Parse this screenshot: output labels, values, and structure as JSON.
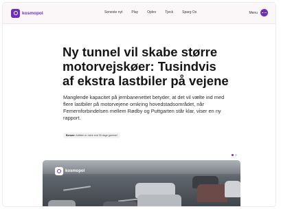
{
  "brand": {
    "name": "kosmopol",
    "logo_icon": "kosmopol-logo-icon",
    "accent_color": "#6f2dbd"
  },
  "nav": {
    "items": [
      {
        "label": "Seneste nyt"
      },
      {
        "label": "Play"
      },
      {
        "label": "Oplev"
      },
      {
        "label": "Tjeck"
      },
      {
        "label": "Sparg Os"
      }
    ],
    "menu_label": "Menu",
    "menu_icon": "more-dots-icon"
  },
  "article": {
    "headline": "Ny tunnel vil skabe større motorvejskøer: Tusindvis af ekstra lastbiler på vejene",
    "lead": "Manglende kapacitet på jernbanenettet betyder, at det vil vælte ind med flere lastbiler på motorvejene omkring hovedstadsområdet, når Femernforbindelsen mellem Rødby og Puttgarten står klar, viser en ny rapport.",
    "byline_label": "Benarn:",
    "byline_text": "Artiklen er mere end 30 dage gammel"
  },
  "carousel": {
    "total": 2,
    "active_index": 0
  },
  "hero": {
    "overlay_brand": "kosmopol"
  }
}
